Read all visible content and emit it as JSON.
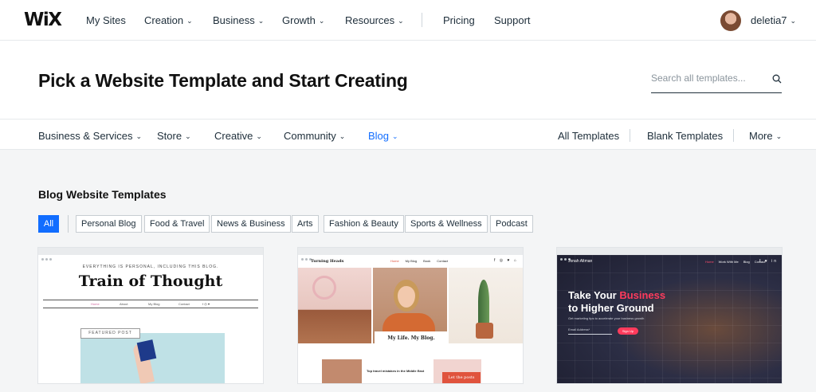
{
  "brand": {
    "logo": "WiX"
  },
  "topnav": {
    "items": [
      {
        "label": "My Sites"
      },
      {
        "label": "Creation"
      },
      {
        "label": "Business"
      },
      {
        "label": "Growth"
      },
      {
        "label": "Resources"
      },
      {
        "label": "Pricing"
      },
      {
        "label": "Support"
      }
    ],
    "username": "deletia7"
  },
  "hero": {
    "title": "Pick a Website Template and Start Creating",
    "search_placeholder": "Search all templates..."
  },
  "categories": {
    "items": [
      "Business & Services",
      "Store",
      "Creative",
      "Community",
      "Blog"
    ],
    "active": "Blog",
    "right": [
      "All Templates",
      "Blank Templates",
      "More"
    ]
  },
  "section": {
    "title": "Blog Website Templates",
    "filters": [
      "All",
      "Personal Blog",
      "Food & Travel",
      "News & Business",
      "Arts",
      "Fashion & Beauty",
      "Sports & Wellness",
      "Podcast"
    ],
    "active_filter": "All"
  },
  "cards": [
    {
      "tagline": "EVERYTHING IS PERSONAL, INCLUDING THIS BLOG.",
      "title": "Train of Thought",
      "featured": "FEATURED POST"
    },
    {
      "brand": "Turning Heads",
      "banner": "My Life. My Blog.",
      "post_text": "Top travel mistakes in the Middle East",
      "button": "Let the posts"
    },
    {
      "brand": "Jonah Altman",
      "headline_1": "Take Your ",
      "headline_accent": "Business",
      "headline_2": "to Higher Ground",
      "subtext": "Get marketing tips to accelerate your business growth",
      "input": "Email Address*",
      "button": "Sign Up"
    }
  ],
  "colors": {
    "accent": "#116dff",
    "text": "#20303c",
    "background": "#f4f5f6",
    "highlight": "#ff3b5c"
  }
}
